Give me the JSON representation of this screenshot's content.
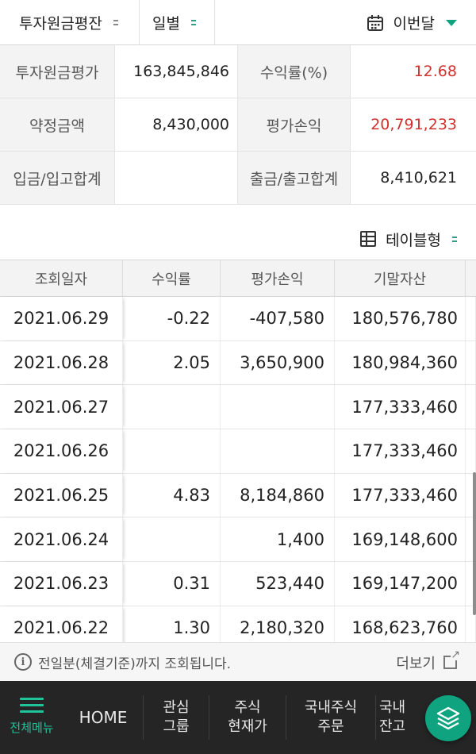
{
  "filters": {
    "account_type": "투자원금평잔",
    "period_unit": "일별",
    "period_range": "이번달"
  },
  "summary": {
    "principal_label": "투자원금평가",
    "principal_value": "163,845,846",
    "return_label": "수익률(%)",
    "return_value": "12.68",
    "contract_label": "약정금액",
    "contract_value": "8,430,000",
    "pnl_label": "평가손익",
    "pnl_value": "20,791,233",
    "deposit_label": "입금/입고합계",
    "deposit_value": "",
    "withdraw_label": "출금/출고합계",
    "withdraw_value": "8,410,621"
  },
  "view_toggle": {
    "label": "테이블형"
  },
  "table": {
    "headers": [
      "조회일자",
      "수익률",
      "평가손익",
      "기말자산"
    ],
    "rows": [
      {
        "date": "2021.06.29",
        "rate": "-0.22",
        "pnl": "-407,580",
        "asset": "180,576,780",
        "tone": "blue"
      },
      {
        "date": "2021.06.28",
        "rate": "2.05",
        "pnl": "3,650,900",
        "asset": "180,984,360",
        "tone": "red"
      },
      {
        "date": "2021.06.27",
        "rate": "",
        "pnl": "",
        "asset": "177,333,460",
        "tone": ""
      },
      {
        "date": "2021.06.26",
        "rate": "",
        "pnl": "",
        "asset": "177,333,460",
        "tone": ""
      },
      {
        "date": "2021.06.25",
        "rate": "4.83",
        "pnl": "8,184,860",
        "asset": "177,333,460",
        "tone": "red"
      },
      {
        "date": "2021.06.24",
        "rate": "",
        "pnl": "1,400",
        "asset": "169,148,600",
        "tone": "red"
      },
      {
        "date": "2021.06.23",
        "rate": "0.31",
        "pnl": "523,440",
        "asset": "169,147,200",
        "tone": "red"
      },
      {
        "date": "2021.06.22",
        "rate": "1.30",
        "pnl": "2,180,320",
        "asset": "168,623,760",
        "tone": "red"
      }
    ]
  },
  "notice": {
    "text": "전일분(체결기준)까지 조회됩니다.",
    "more_label": "더보기"
  },
  "bottom_nav": {
    "menu_label": "전체메뉴",
    "home_label": "HOME",
    "fav_line1": "관심",
    "fav_line2": "그룹",
    "stock_line1": "주식",
    "stock_line2": "현재가",
    "order_line1": "국내주식",
    "order_line2": "주문",
    "more_line1": "국내",
    "more_line2": "잔고"
  },
  "colors": {
    "accent": "#0fa37f",
    "positive": "#d0322e",
    "negative": "#2a78d4"
  }
}
